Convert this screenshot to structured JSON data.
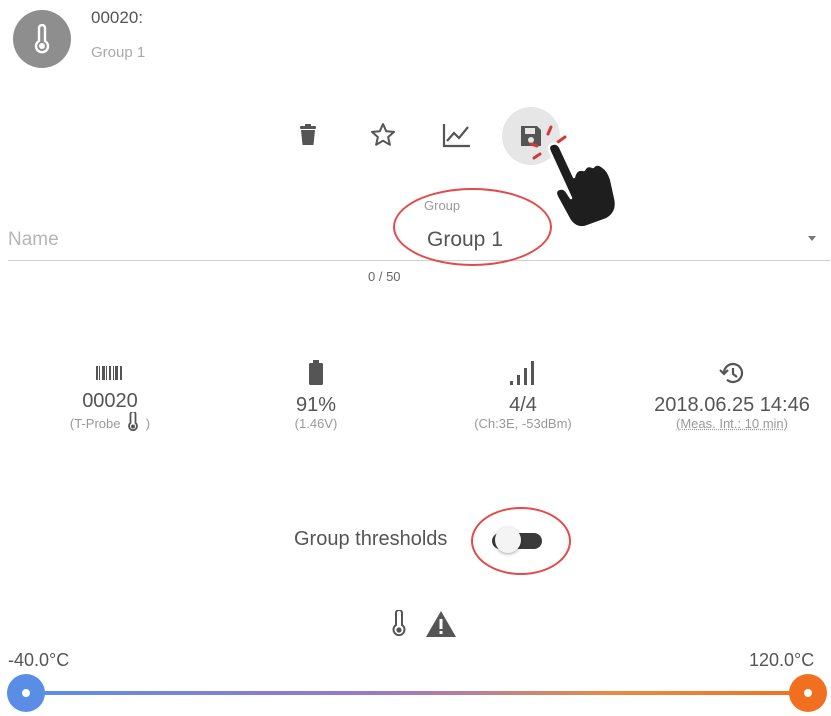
{
  "header": {
    "device_id": "00020:",
    "group": "Group 1",
    "avatar_icon": "thermometer-icon"
  },
  "toolbar": {
    "delete_icon": "trash-icon",
    "favorite_icon": "star-icon",
    "chart_icon": "chart-line-icon",
    "save_icon": "save-icon",
    "pointer_icon": "hand-pointer-icon"
  },
  "form": {
    "name_placeholder": "Name",
    "group_label": "Group",
    "group_value": "Group 1",
    "counter": "0 / 50"
  },
  "stats": {
    "barcode": {
      "icon": "barcode-icon",
      "value": "00020",
      "sub": "(T-Probe",
      "sub_end": ")"
    },
    "battery": {
      "icon": "battery-icon",
      "value": "91%",
      "sub": "(1.46V)"
    },
    "signal": {
      "icon": "signal-icon",
      "value": "4/4",
      "sub": "(Ch:3E, -53dBm)"
    },
    "history": {
      "icon": "history-icon",
      "value": "2018.06.25 14:46",
      "sub": "(Meas. Int.: 10 min)"
    }
  },
  "thresholds": {
    "label": "Group thresholds",
    "enabled": false,
    "icons": [
      "thermometer-icon",
      "warning-icon"
    ]
  },
  "range": {
    "min_label": "-40.0°C",
    "max_label": "120.0°C",
    "min": -40.0,
    "max": 120.0,
    "low_color": "#5a8ee6",
    "high_color": "#f07020"
  },
  "colors": {
    "annotation": "#e34a4a",
    "avatar": "#8e8e8e"
  }
}
